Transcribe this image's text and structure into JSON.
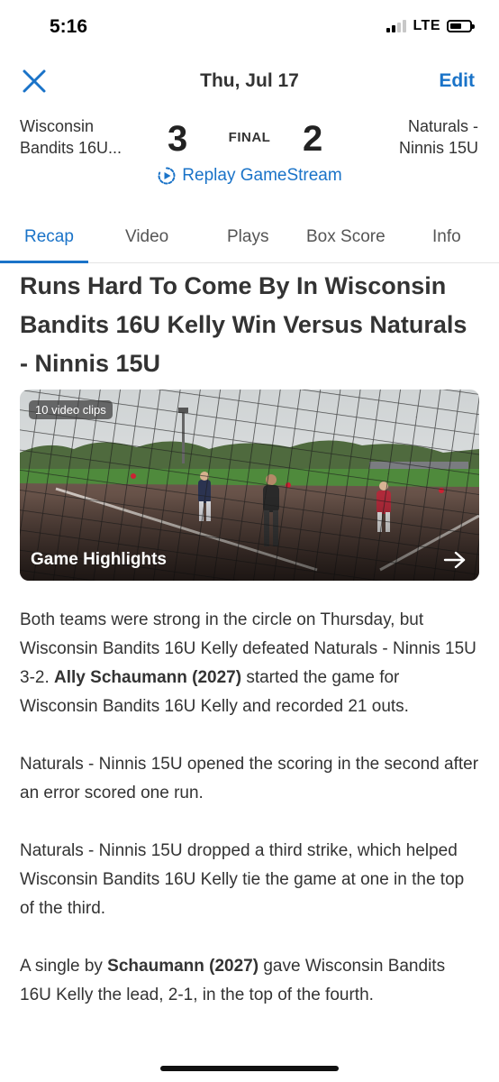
{
  "status_bar": {
    "time": "5:16",
    "network": "LTE"
  },
  "nav": {
    "close_icon": "close-icon",
    "date": "Thu, Jul 17",
    "edit_label": "Edit"
  },
  "game": {
    "home_team": "Wisconsin Bandits 16U...",
    "home_team_line1": "Wisconsin",
    "home_team_line2": "Bandits 16U...",
    "home_score": "3",
    "status": "FINAL",
    "away_score": "2",
    "away_team_line1": "Naturals -",
    "away_team_line2": "Ninnis 15U"
  },
  "replay": {
    "icon": "replay-play-icon",
    "label": "Replay GameStream"
  },
  "tabs": [
    {
      "label": "Recap",
      "active": true
    },
    {
      "label": "Video",
      "active": false
    },
    {
      "label": "Plays",
      "active": false
    },
    {
      "label": "Box Score",
      "active": false
    },
    {
      "label": "Info",
      "active": false
    }
  ],
  "article": {
    "headline": "Runs Hard To Come By In Wisconsin Bandits 16U Kelly Win Versus Naturals - Ninnis 15U",
    "media": {
      "clips_badge": "10 video clips",
      "title": "Game Highlights",
      "arrow_icon": "arrow-right-icon"
    },
    "paragraphs": [
      [
        {
          "text": "Both teams were strong in the circle on Thursday, but Wisconsin Bandits 16U Kelly defeated Naturals - Ninnis 15U 3-2. ",
          "bold": false
        },
        {
          "text": "Ally Schaumann (2027)",
          "bold": true
        },
        {
          "text": " started the game for Wisconsin Bandits 16U Kelly and recorded 21 outs.",
          "bold": false
        }
      ],
      [
        {
          "text": "Naturals - Ninnis 15U opened the scoring in the second after an error scored one run.",
          "bold": false
        }
      ],
      [
        {
          "text": "Naturals - Ninnis 15U dropped a third strike, which helped Wisconsin Bandits 16U Kelly tie the game at one in the top of the third.",
          "bold": false
        }
      ],
      [
        {
          "text": "A single by ",
          "bold": false
        },
        {
          "text": "Schaumann (2027)",
          "bold": true
        },
        {
          "text": " gave Wisconsin Bandits 16U Kelly the lead, 2-1, in the top of the fourth.",
          "bold": false
        }
      ]
    ]
  },
  "colors": {
    "accent": "#1a73c8",
    "text": "#333333",
    "field_dirt": "#5e4a42",
    "field_grass": "#4f8a3c"
  }
}
